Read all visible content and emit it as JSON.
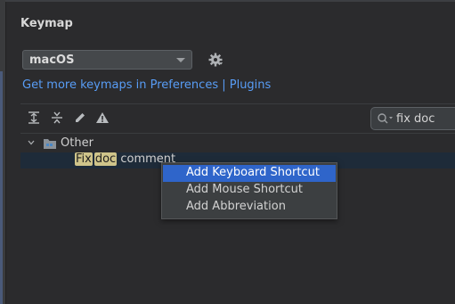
{
  "page": {
    "title": "Keymap"
  },
  "keymap": {
    "selected_scheme": "macOS",
    "link_text": "Get more keymaps in Preferences | Plugins"
  },
  "toolbar": {
    "icons": [
      "expand-all-icon",
      "collapse-all-icon",
      "edit-icon",
      "warning-icon"
    ]
  },
  "search": {
    "value": "fix doc"
  },
  "tree": {
    "group_label": "Other",
    "action": {
      "parts": [
        "Fix",
        "doc",
        "comment"
      ],
      "highlighted": [
        "Fix",
        "doc"
      ]
    }
  },
  "context_menu": {
    "items": [
      {
        "label": "Add Keyboard Shortcut",
        "selected": true
      },
      {
        "label": "Add Mouse Shortcut",
        "selected": false
      },
      {
        "label": "Add Abbreviation",
        "selected": false
      }
    ]
  },
  "colors": {
    "accent": "#2f65ca",
    "link": "#589df6",
    "highlight": "#cfc48a"
  }
}
